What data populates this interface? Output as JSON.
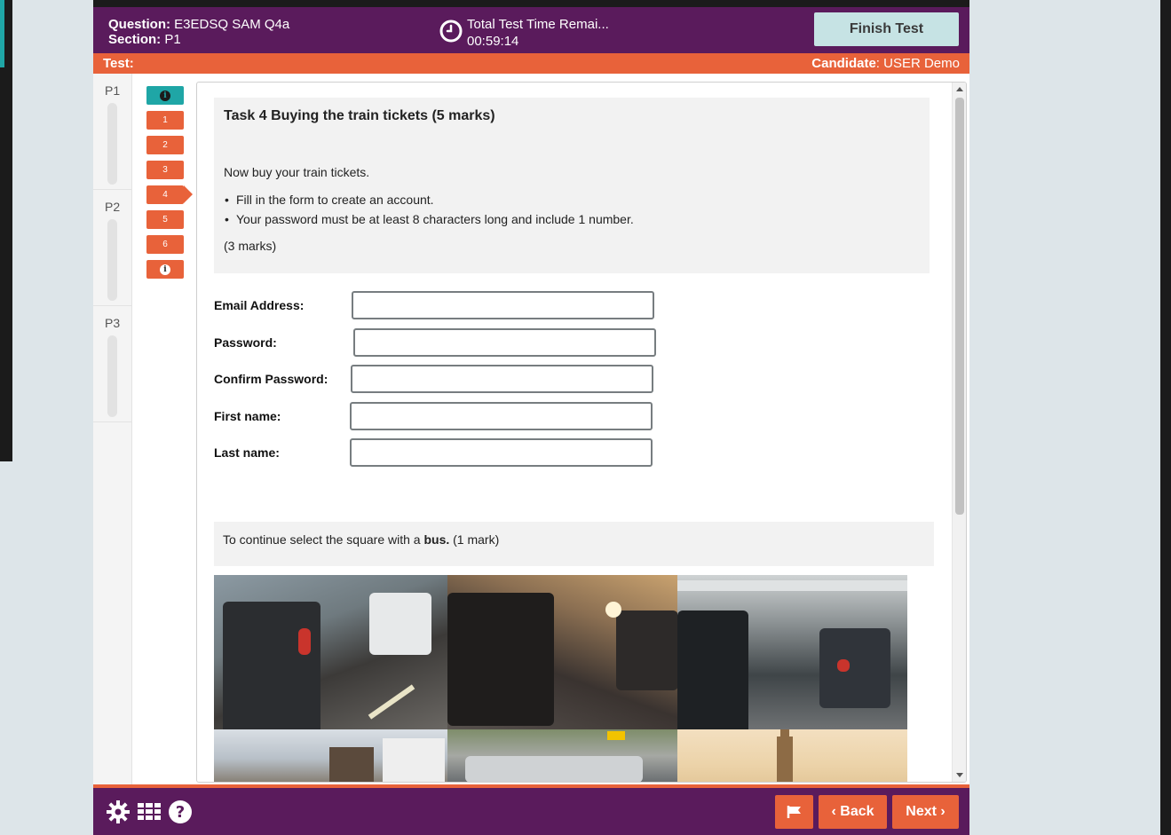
{
  "header": {
    "question_label": "Question:",
    "question_value": "E3EDSQ SAM Q4a",
    "section_label": "Section:",
    "section_value": "P1",
    "timer_title": "Total Test Time Remai...",
    "timer_value": "00:59:14",
    "finish_label": "Finish Test"
  },
  "subheader": {
    "test_label": "Test:",
    "candidate_label": "Candidate",
    "candidate_value": ": USER Demo"
  },
  "sections": [
    {
      "label": "P1"
    },
    {
      "label": "P2"
    },
    {
      "label": "P3"
    }
  ],
  "question_nav": {
    "info_top": "i",
    "items": [
      "1",
      "2",
      "3",
      "4",
      "5",
      "6"
    ],
    "info_bottom": "i",
    "active": "4"
  },
  "task": {
    "title": "Task 4 Buying the train tickets (5 marks)",
    "intro": "Now buy your train tickets.",
    "bullets": [
      "Fill in the form to create an account.",
      "Your password must be at least 8 characters long and include 1 number."
    ],
    "marks": "(3 marks)"
  },
  "form": {
    "email_label": "Email Address:",
    "password_label": "Password:",
    "confirm_label": "Confirm Password:",
    "first_label": "First name:",
    "last_label": "Last name:",
    "email_value": "",
    "password_value": "",
    "confirm_value": "",
    "first_value": "",
    "last_value": ""
  },
  "captcha": {
    "prefix": "To continue select the square with a ",
    "target": "bus.",
    "suffix": " (1 mark)"
  },
  "footer": {
    "back_label": "Back",
    "next_label": "Next"
  },
  "colors": {
    "purple": "#5a1b5c",
    "orange": "#e8623a",
    "teal": "#1fa6a6",
    "finish_bg": "#c6e3e4"
  }
}
